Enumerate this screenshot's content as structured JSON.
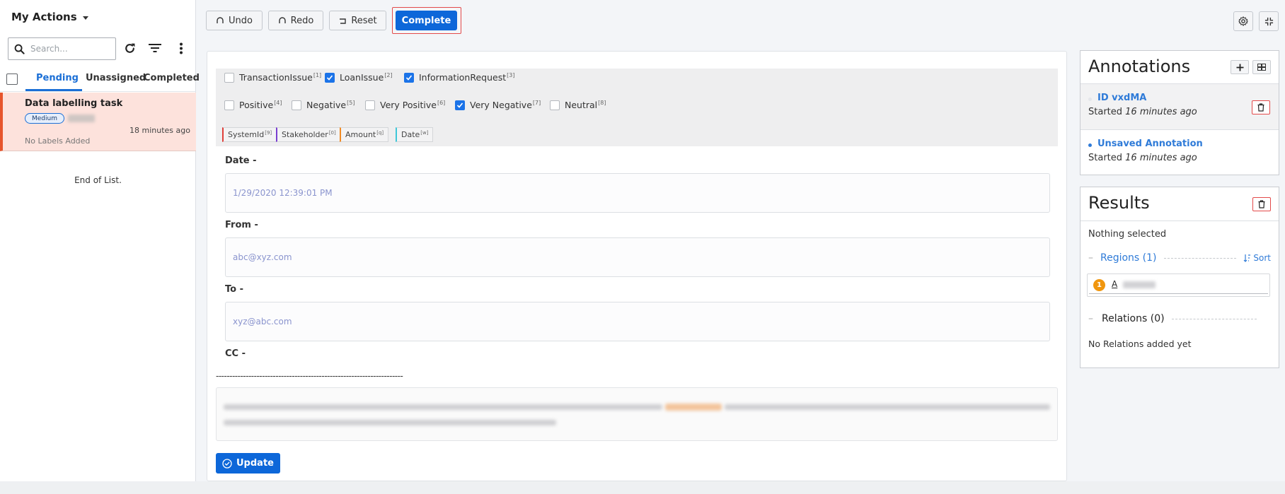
{
  "left_panel": {
    "title": "My Actions",
    "search_placeholder": "Search...",
    "tabs": [
      "Pending",
      "Unassigned",
      "Completed"
    ],
    "task": {
      "title": "Data labelling task",
      "priority": "Medium",
      "time": "18 minutes ago",
      "labels_status": "No Labels Added"
    },
    "end_of_list": "End of List."
  },
  "toolbar": {
    "undo": "Undo",
    "redo": "Redo",
    "reset": "Reset",
    "complete": "Complete"
  },
  "labels": {
    "row1": [
      {
        "text": "TransactionIssue",
        "key": "[1]",
        "checked": false
      },
      {
        "text": "LoanIssue",
        "key": "[2]",
        "checked": true
      },
      {
        "text": "InformationRequest",
        "key": "[3]",
        "checked": true
      }
    ],
    "row2": [
      {
        "text": "Positive",
        "key": "[4]",
        "checked": false
      },
      {
        "text": "Negative",
        "key": "[5]",
        "checked": false
      },
      {
        "text": "Very Positive",
        "key": "[6]",
        "checked": false
      },
      {
        "text": "Very Negative",
        "key": "[7]",
        "checked": true
      },
      {
        "text": "Neutral",
        "key": "[8]",
        "checked": false
      }
    ],
    "tags": [
      {
        "text": "SystemId",
        "key": "[9]",
        "color": "#e0403a"
      },
      {
        "text": "Stakeholder",
        "key": "[0]",
        "color": "#7a3fd0"
      },
      {
        "text": "Amount",
        "key": "[q]",
        "color": "#f08a24"
      },
      {
        "text": "Date",
        "key": "[w]",
        "color": "#3ec7d8"
      }
    ]
  },
  "email": {
    "date_label": "Date -",
    "date_value": "1/29/2020 12:39:01 PM",
    "from_label": "From -",
    "from_value": "abc@xyz.com",
    "to_label": "To -",
    "to_value": "xyz@abc.com",
    "cc_label": "CC -",
    "separator": "---------------------------------------------------------------------"
  },
  "update_button": "Update",
  "annotations": {
    "title": "Annotations",
    "items": [
      {
        "id": "ID vxdMA",
        "started_prefix": "Started",
        "started_time": "16 minutes ago"
      },
      {
        "id": "Unsaved Annotation",
        "started_prefix": "Started",
        "started_time": "16 minutes ago"
      }
    ]
  },
  "results": {
    "title": "Results",
    "nothing_selected": "Nothing selected",
    "regions_label": "Regions (1)",
    "sort_label": "Sort",
    "region": {
      "number": "1",
      "label": "A"
    },
    "relations_label": "Relations (0)",
    "no_relations": "No Relations added yet"
  },
  "colors": {
    "primary": "#0d67d9",
    "task_highlight": "#fde2dc",
    "task_accent": "#e7552c",
    "highlight_border": "#e34a4a",
    "region_badge": "#f0960e"
  }
}
